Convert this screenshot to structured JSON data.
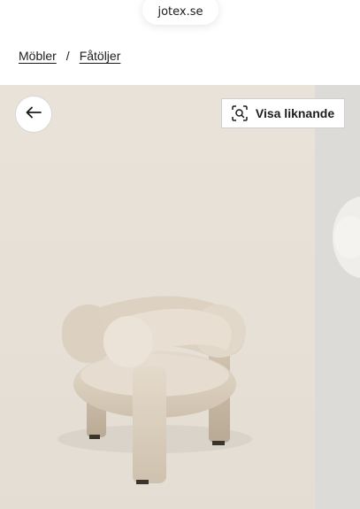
{
  "browser": {
    "url": "jotex.se"
  },
  "breadcrumb": {
    "items": [
      {
        "label": "Möbler"
      },
      {
        "label": "Fåtöljer"
      }
    ],
    "separator": "/"
  },
  "gallery": {
    "back_icon": "arrow-left-icon",
    "similar_button": {
      "label": "Visa liknande",
      "icon": "visual-search-icon"
    },
    "main_image": "beige-boucle-armchair",
    "next_image": "armchair-partial"
  },
  "colors": {
    "background": "#ffffff",
    "image_bg": "#e6e0d6",
    "next_slide_bg": "#dddbd8",
    "text": "#1c1c1c"
  }
}
